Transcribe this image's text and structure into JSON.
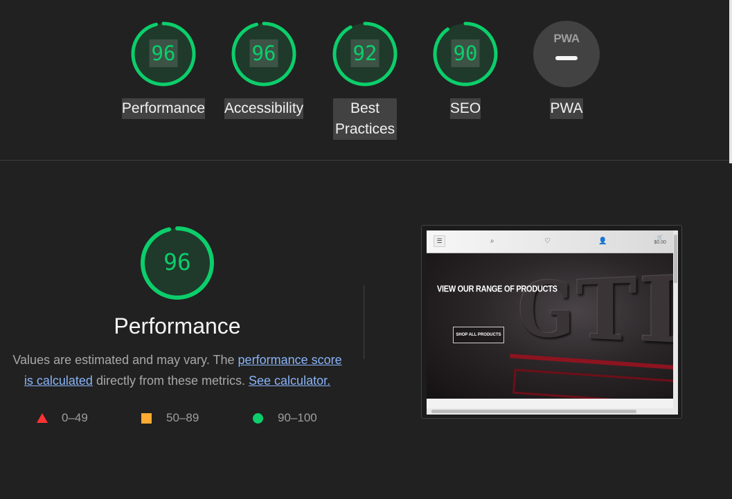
{
  "scores": [
    {
      "label": "Performance",
      "score": "96",
      "value": 96
    },
    {
      "label": "Accessibility",
      "score": "96",
      "value": 96
    },
    {
      "label_line1": "Best",
      "label_line2": "Practices",
      "score": "92",
      "value": 92
    },
    {
      "label": "SEO",
      "score": "90",
      "value": 90
    },
    {
      "label": "PWA",
      "badge": "PWA"
    }
  ],
  "performance": {
    "score": "96",
    "value": 96,
    "title": "Performance",
    "desc_prefix": "Values are estimated and may vary. The ",
    "link_score": "performance score is calculated",
    "desc_middle": " directly from these metrics. ",
    "link_calc": "See calculator."
  },
  "legend": [
    {
      "range": "0–49",
      "color": "#ff3333",
      "icon": "triangle-icon"
    },
    {
      "range": "50–89",
      "color": "#ffaa33",
      "icon": "square-icon"
    },
    {
      "range": "90–100",
      "color": "#0cce6b",
      "icon": "circle-icon"
    }
  ],
  "thumbnail": {
    "cart_total": "$0.00",
    "headline": "VIEW OUR RANGE OF PRODUCTS",
    "button": "SHOP ALL PRODUCTS",
    "hero_text": "GTI"
  },
  "colors": {
    "pass": "#0cce6b",
    "background": "#212121",
    "link": "#8ab4f8"
  }
}
